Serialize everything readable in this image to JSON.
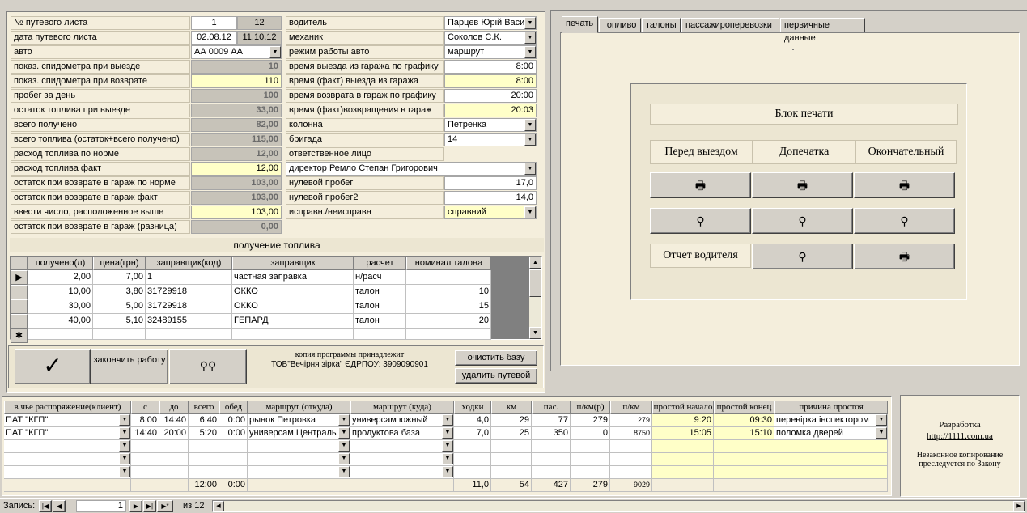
{
  "form": {
    "rows": [
      {
        "label": "№ путевого листа",
        "v1": "1",
        "v2": "12"
      },
      {
        "label": "дата путевого листа",
        "v1": "02.08.12",
        "v2": "11.10.12"
      },
      {
        "label": "авто",
        "v": "АА 0009 АА"
      },
      {
        "label": "показ. спидометра при выезде",
        "v": "10"
      },
      {
        "label": "показ. спидометра при возврате",
        "v": "110"
      },
      {
        "label": "пробег за день",
        "v": "100"
      },
      {
        "label": "остаток топлива при выезде",
        "v": "33,00"
      },
      {
        "label": "всего получено",
        "v": "82,00"
      },
      {
        "label": "всего топлива (остаток+всего получено)",
        "v": "115,00"
      },
      {
        "label": "расход топлива по норме",
        "v": "12,00"
      },
      {
        "label": "расход топлива факт",
        "v": "12,00"
      },
      {
        "label": "остаток при возврате в гараж по норме",
        "v": "103,00"
      },
      {
        "label": "остаток при возврате в гараж  факт",
        "v": "103,00"
      },
      {
        "label": "ввести число, расположенное выше",
        "v": "103,00"
      },
      {
        "label": "остаток при возврате в гараж (разница)",
        "v": "0,00"
      }
    ],
    "mid": [
      {
        "label": "водитель",
        "v": "Парцев Юрій Васи."
      },
      {
        "label": "механик",
        "v": "Соколов С.К."
      },
      {
        "label": "режим работы авто",
        "v": "маршрут"
      },
      {
        "label": "время выезда из гаража по графику",
        "v": "8:00"
      },
      {
        "label": "время (факт) выезда из гаража",
        "v": "8:00"
      },
      {
        "label": "время возврата в гараж по графику",
        "v": "20:00"
      },
      {
        "label": "время (факт)возвращения в гараж",
        "v": "20:03"
      },
      {
        "label": "колонна",
        "v": "Петренка"
      },
      {
        "label": "бригада",
        "v": "14"
      },
      {
        "label": "ответственное лицо",
        "v": ""
      },
      {
        "label": "директор Ремло Степан Григорович",
        "v": ""
      },
      {
        "label": "нулевой пробег",
        "v": "17,0"
      },
      {
        "label": "нулевой пробег2",
        "v": "14,0"
      },
      {
        "label": "исправн./неисправн",
        "v": "справний"
      }
    ]
  },
  "fuel": {
    "title": "получение топлива",
    "headers": [
      "получено(л)",
      "цена(грн)",
      "заправщик(код)",
      "заправщик",
      "расчет",
      "номинал талона"
    ],
    "rows": [
      [
        "2,00",
        "7,00",
        "1",
        "частная заправка",
        "н/расч",
        ""
      ],
      [
        "10,00",
        "3,80",
        "31729918",
        "ОККО",
        "талон",
        "10"
      ],
      [
        "30,00",
        "5,00",
        "31729918",
        "ОККО",
        "талон",
        "15"
      ],
      [
        "40,00",
        "5,10",
        "32489155",
        "ГЕПАРД",
        "талон",
        "20"
      ]
    ]
  },
  "actions": {
    "finish_label": "закончить работу",
    "owner_line1": "копия программы принадлежит",
    "owner_line2": "ТОВ\"Вечірня зірка\"     ЄДРПОУ: 3909090901",
    "clear_db": "очистить базу",
    "delete_sheet": "удалить путевой"
  },
  "tabs": [
    "печать",
    "топливо",
    "талоны",
    "пассажироперевозки",
    "первичные данные"
  ],
  "print": {
    "title": "Блок печати",
    "before": "Перед выездом",
    "reprint": "Допечатка",
    "final": "Окончательный",
    "driver_report": "Отчет водителя"
  },
  "routes": {
    "headers": [
      "в чье распоряжение(клиент)",
      "с",
      "до",
      "всего",
      "обед",
      "маршрут (откуда)",
      "маршрут (куда)",
      "ходки",
      "км",
      "пас.",
      "п/км(р)",
      "п/км",
      "простой начало",
      "простой конец",
      "причина простоя"
    ],
    "rows": [
      [
        "ПАТ \"КГП\"",
        "8:00",
        "14:40",
        "6:40",
        "0:00",
        "рынок Петровка",
        "универсам южный",
        "4,0",
        "29",
        "77",
        "279",
        "279",
        "9:20",
        "09:30",
        "перевірка інспектором"
      ],
      [
        "ПАТ \"КГП\"",
        "14:40",
        "20:00",
        "5:20",
        "0:00",
        "универсам Централь",
        "продуктова база",
        "7,0",
        "25",
        "350",
        "0",
        "8750",
        "15:05",
        "15:10",
        "поломка дверей"
      ]
    ],
    "totals": {
      "total": "12:00",
      "lunch": "0:00",
      "trips": "11,0",
      "km": "54",
      "pas": "427",
      "pkmr": "279",
      "pkm": "9029"
    }
  },
  "dev": {
    "line1": "Разработка",
    "link": "http://1111.com.ua",
    "warn1": "Незаконное копирование",
    "warn2": "преследуется по Закону"
  },
  "nav": {
    "label": "Запись:",
    "current": "1",
    "of": "из 12"
  }
}
